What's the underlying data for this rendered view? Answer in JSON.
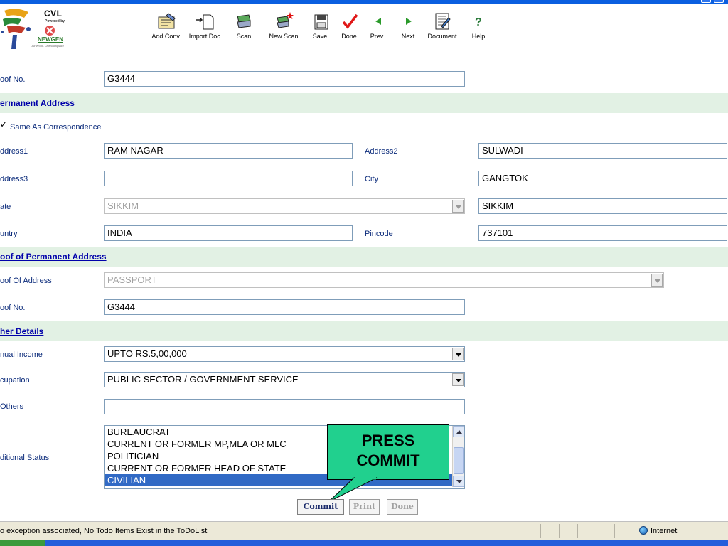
{
  "logo": {
    "name": "CVL",
    "powered_by": "Powered by",
    "vendor": "NEWGEN",
    "tagline": "Our World. Our Workplace"
  },
  "toolbar": {
    "add_conv": "Add Conv.",
    "import_doc": "Import Doc.",
    "scan": "Scan",
    "new_scan": "New Scan",
    "save": "Save",
    "done": "Done",
    "prev": "Prev",
    "next": "Next",
    "document": "Document",
    "help": "Help"
  },
  "form": {
    "proof_no_top": {
      "label": "oof No.",
      "value": "G3444"
    },
    "permanent_address": {
      "title": "ermanent Address",
      "same_as": "Same As Correspondence",
      "address1": {
        "label": "ddress1",
        "value": "RAM NAGAR"
      },
      "address2": {
        "label": "Address2",
        "value": "SULWADI"
      },
      "address3": {
        "label": "ddress3",
        "value": ""
      },
      "city": {
        "label": "City",
        "value": "GANGTOK"
      },
      "state": {
        "label": "ate",
        "value": "SIKKIM",
        "other_value": "SIKKIM"
      },
      "country": {
        "label": "untry",
        "value": "INDIA"
      },
      "pincode": {
        "label": "Pincode",
        "value": "737101"
      }
    },
    "proof_permanent": {
      "title": "oof of Permanent Address",
      "proof_of_address": {
        "label": "oof Of Address",
        "value": "PASSPORT"
      },
      "proof_no": {
        "label": "oof No.",
        "value": "G3444"
      }
    },
    "other_details": {
      "title": "her Details",
      "annual_income": {
        "label": "nual Income",
        "value": "UPTO RS.5,00,000"
      },
      "occupation": {
        "label": "cupation",
        "value": "PUBLIC SECTOR / GOVERNMENT SERVICE"
      },
      "others": {
        "label": "Others",
        "value": ""
      },
      "additional_status": {
        "label": "ditional Status",
        "options": [
          "BUREAUCRAT",
          "CURRENT OR FORMER MP,MLA OR MLC",
          "POLITICIAN",
          "CURRENT OR FORMER HEAD OF STATE",
          "CIVILIAN"
        ],
        "selected": "CIVILIAN"
      }
    }
  },
  "callout": {
    "line1": "PRESS",
    "line2": "COMMIT"
  },
  "buttons": {
    "commit": "Commit",
    "print": "Print",
    "done": "Done"
  },
  "status": {
    "text": "o exception associated, No Todo Items Exist in the ToDoList",
    "zone": "Internet"
  },
  "colors": {
    "section_bg": "#e2f1e4",
    "section_title": "#0000aa",
    "selection": "#316ac5",
    "callout_bg": "#21d08e",
    "titlebar": "#0a5fe0"
  }
}
